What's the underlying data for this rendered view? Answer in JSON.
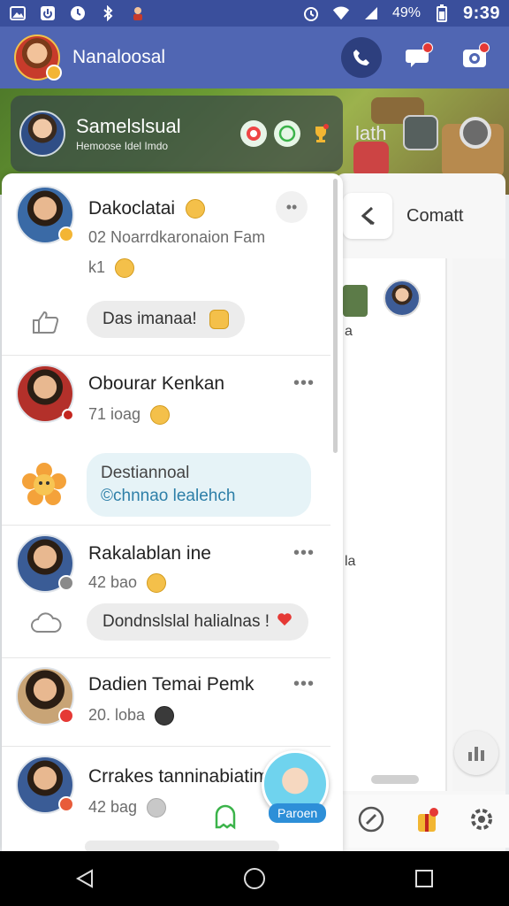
{
  "status_bar": {
    "battery_pct": "49%",
    "time": "9:39"
  },
  "header": {
    "title": "Nanaloosal",
    "accent": "#5066b3"
  },
  "drawer_top": {
    "name": "Samelslsual",
    "sub": "Hemoose Idel Imdo"
  },
  "right_panel": {
    "ghost_text": "lath",
    "title": "Comatt",
    "letters": [
      "a",
      "la"
    ]
  },
  "cards": [
    {
      "name": "Dakoclatai",
      "meta": "02 Noarrdkaronaion Fam",
      "meta2": "k1",
      "pill": "Das imanaa!"
    },
    {
      "name": "Obourar Kenkan",
      "meta": "71 ioag",
      "bubble_l1": "Destiannoal",
      "bubble_l2": "©chnnao lealehch"
    },
    {
      "name": "Rakalablan ine",
      "meta": "42 bao",
      "pill": "Dondnslslal halialnas !"
    },
    {
      "name": "Dadien Temai Pemk",
      "meta": "20. loba"
    },
    {
      "name": "Crrakes tanninabiatim",
      "meta": "42 bag"
    }
  ],
  "fab": {
    "label": "Paroen"
  }
}
